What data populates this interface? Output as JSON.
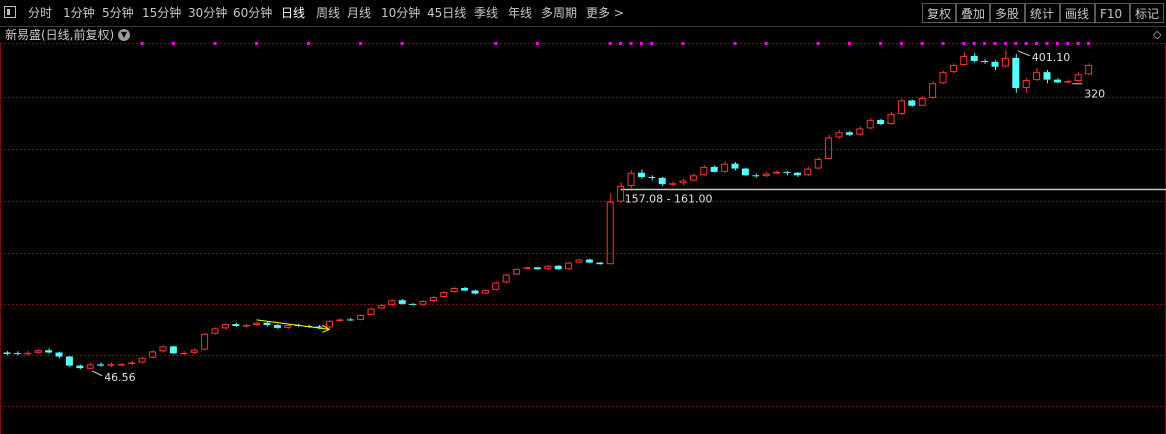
{
  "toolbar": {
    "periods": [
      {
        "label": "分时",
        "active": false
      },
      {
        "label": "1分钟",
        "active": false
      },
      {
        "label": "5分钟",
        "active": false
      },
      {
        "label": "15分钟",
        "active": false
      },
      {
        "label": "30分钟",
        "active": false
      },
      {
        "label": "60分钟",
        "active": false
      },
      {
        "label": "日线",
        "active": true
      },
      {
        "label": "周线",
        "active": false
      },
      {
        "label": "月线",
        "active": false
      },
      {
        "label": "10分钟",
        "active": false
      },
      {
        "label": "45日线",
        "active": false
      },
      {
        "label": "季线",
        "active": false
      },
      {
        "label": "年线",
        "active": false
      },
      {
        "label": "多周期",
        "active": false
      },
      {
        "label": "更多 >",
        "active": false
      }
    ],
    "right_buttons": [
      "复权",
      "叠加",
      "多股",
      "统计",
      "画线",
      "F10",
      "标记"
    ]
  },
  "stock_title": "新易盛(日线,前复权)",
  "colors": {
    "up": "#ff3232",
    "down": "#54ffff",
    "grid": "#7a1010",
    "marker": "#ff00ff",
    "trendline": "#ffff00",
    "level_line": "#c8c8c8",
    "active_tab": "#ffffff"
  },
  "chart_data": {
    "type": "candlestick",
    "y_range": [
      30,
      420
    ],
    "candles": [
      [
        52.0,
        51.5,
        52.5,
        51.0
      ],
      [
        51.8,
        51.6,
        52.4,
        51.0
      ],
      [
        51.5,
        51.9,
        52.5,
        51.0
      ],
      [
        51.9,
        52.8,
        53.2,
        51.5
      ],
      [
        52.8,
        52.0,
        53.5,
        51.6
      ],
      [
        52.0,
        50.6,
        52.3,
        50.0
      ],
      [
        50.6,
        47.6,
        50.8,
        47.2
      ],
      [
        47.6,
        46.8,
        48.0,
        46.4
      ],
      [
        46.6,
        48.0,
        48.6,
        46.56
      ],
      [
        48.0,
        47.6,
        48.6,
        47.2
      ],
      [
        47.6,
        48.1,
        48.6,
        47.2
      ],
      [
        48.1,
        48.1,
        48.6,
        47.6
      ],
      [
        48.1,
        48.6,
        49.2,
        47.8
      ],
      [
        48.6,
        50.2,
        50.6,
        48.4
      ],
      [
        50.2,
        52.4,
        52.8,
        50.0
      ],
      [
        52.4,
        54.2,
        54.5,
        52.0
      ],
      [
        54.2,
        51.7,
        54.5,
        51.4
      ],
      [
        51.7,
        51.9,
        52.4,
        51.2
      ],
      [
        51.9,
        53.0,
        53.5,
        51.5
      ],
      [
        53.0,
        59.0,
        59.4,
        52.8
      ],
      [
        59.0,
        61.2,
        61.6,
        58.6
      ],
      [
        61.2,
        63.0,
        63.4,
        60.6
      ],
      [
        63.0,
        62.2,
        63.6,
        61.8
      ],
      [
        62.2,
        62.6,
        63.0,
        61.6
      ],
      [
        62.6,
        63.6,
        64.0,
        62.0
      ],
      [
        63.6,
        62.6,
        64.2,
        62.0
      ],
      [
        62.6,
        61.4,
        63.0,
        61.0
      ],
      [
        61.4,
        62.6,
        63.0,
        61.0
      ],
      [
        62.6,
        62.2,
        63.2,
        61.8
      ],
      [
        62.2,
        62.0,
        62.8,
        61.4
      ],
      [
        62.0,
        61.6,
        62.6,
        61.0
      ],
      [
        61.6,
        64.4,
        64.8,
        61.4
      ],
      [
        64.4,
        65.0,
        65.4,
        64.0
      ],
      [
        65.0,
        64.8,
        65.6,
        64.4
      ],
      [
        64.8,
        67.0,
        67.4,
        64.6
      ],
      [
        67.0,
        70.0,
        70.4,
        66.8
      ],
      [
        70.0,
        71.6,
        72.0,
        69.6
      ],
      [
        71.6,
        74.0,
        74.4,
        71.2
      ],
      [
        74.0,
        72.2,
        74.6,
        71.8
      ],
      [
        72.2,
        71.8,
        72.6,
        71.4
      ],
      [
        71.8,
        73.6,
        74.0,
        71.4
      ],
      [
        73.6,
        75.6,
        76.0,
        73.2
      ],
      [
        75.6,
        78.2,
        78.6,
        75.2
      ],
      [
        78.2,
        80.4,
        80.8,
        77.8
      ],
      [
        80.4,
        79.0,
        81.0,
        78.6
      ],
      [
        79.0,
        77.4,
        79.4,
        77.0
      ],
      [
        77.4,
        79.4,
        79.8,
        77.0
      ],
      [
        79.4,
        83.4,
        83.8,
        79.0
      ],
      [
        83.4,
        88.0,
        88.4,
        83.0
      ],
      [
        88.0,
        91.4,
        91.8,
        87.6
      ],
      [
        91.4,
        92.4,
        92.8,
        91.0
      ],
      [
        92.4,
        91.2,
        92.8,
        90.8
      ],
      [
        91.2,
        93.4,
        93.8,
        90.8
      ],
      [
        93.4,
        91.2,
        93.8,
        90.8
      ],
      [
        91.2,
        95.4,
        95.8,
        90.8
      ],
      [
        95.4,
        97.4,
        97.8,
        95.0
      ],
      [
        97.4,
        95.4,
        98.0,
        95.0
      ],
      [
        95.4,
        94.4,
        95.8,
        94.0
      ],
      [
        94.4,
        144.0,
        152.0,
        94.0
      ],
      [
        144.0,
        160.0,
        164.0,
        143.0
      ],
      [
        160.0,
        175.0,
        178.0,
        158.0
      ],
      [
        175.0,
        170.0,
        179.0,
        168.0
      ],
      [
        170.0,
        169.0,
        172.0,
        166.0
      ],
      [
        169.0,
        162.0,
        170.0,
        160.0
      ],
      [
        162.0,
        163.0,
        165.0,
        160.0
      ],
      [
        163.0,
        166.0,
        168.0,
        161.0
      ],
      [
        166.0,
        172.0,
        174.0,
        165.0
      ],
      [
        172.0,
        182.0,
        184.0,
        171.0
      ],
      [
        182.0,
        176.0,
        184.0,
        175.0
      ],
      [
        176.0,
        186.0,
        189.0,
        175.0
      ],
      [
        186.0,
        180.0,
        188.0,
        178.0
      ],
      [
        180.0,
        172.0,
        181.0,
        171.0
      ],
      [
        172.0,
        171.0,
        174.0,
        169.0
      ],
      [
        171.0,
        174.0,
        176.0,
        170.0
      ],
      [
        174.0,
        176.0,
        178.0,
        173.0
      ],
      [
        176.0,
        175.0,
        177.0,
        172.0
      ],
      [
        175.0,
        172.0,
        176.0,
        170.0
      ],
      [
        172.0,
        180.0,
        182.0,
        171.0
      ],
      [
        180.0,
        192.0,
        194.0,
        179.0
      ],
      [
        192.0,
        222.0,
        226.0,
        191.0
      ],
      [
        222.0,
        230.0,
        233.0,
        220.0
      ],
      [
        230.0,
        226.0,
        232.0,
        224.0
      ],
      [
        226.0,
        236.0,
        239.0,
        225.0
      ],
      [
        236.0,
        250.0,
        253.0,
        235.0
      ],
      [
        250.0,
        243.0,
        252.0,
        241.0
      ],
      [
        243.0,
        260.0,
        264.0,
        242.0
      ],
      [
        260.0,
        285.0,
        289.0,
        258.0
      ],
      [
        285.0,
        275.0,
        287.0,
        273.0
      ],
      [
        275.0,
        290.0,
        294.0,
        274.0
      ],
      [
        290.0,
        320.0,
        324.0,
        288.0
      ],
      [
        320.0,
        345.0,
        348.0,
        318.0
      ],
      [
        345.0,
        362.0,
        366.0,
        342.0
      ],
      [
        362.0,
        385.0,
        395.0,
        360.0
      ],
      [
        385.0,
        372.0,
        392.0,
        368.0
      ],
      [
        372.0,
        370.0,
        376.0,
        365.0
      ],
      [
        370.0,
        358.0,
        374.0,
        350.0
      ],
      [
        358.0,
        380.0,
        401.1,
        356.0
      ],
      [
        380.0,
        310.0,
        390.0,
        300.0
      ],
      [
        310.0,
        327.0,
        332.0,
        300.0
      ],
      [
        327.0,
        345.0,
        355.0,
        325.0
      ],
      [
        345.0,
        328.0,
        350.0,
        320.0
      ],
      [
        328.0,
        322.0,
        331.0,
        320.0
      ],
      [
        322.0,
        325.0,
        328.0,
        320.0
      ],
      [
        325.0,
        340.0,
        345.0,
        323.0
      ],
      [
        340.0,
        362.0,
        366.0,
        338.0
      ]
    ],
    "top_markers_at_candle_index": [
      13,
      16,
      20,
      24,
      29,
      34,
      38,
      47,
      51,
      58,
      59,
      60,
      61,
      62,
      65,
      70,
      73,
      78,
      81,
      84,
      86,
      88,
      90,
      92,
      93,
      94,
      95,
      96,
      97,
      98,
      99,
      100,
      101,
      102,
      103,
      104
    ],
    "annotations": [
      {
        "text": "46.56",
        "value": 46.56,
        "candle_index": 8
      },
      {
        "text": "401.10",
        "value": 401.1,
        "candle_index": 97
      },
      {
        "text": "320",
        "value": 320,
        "candle_index": 103
      },
      {
        "text": "157.08 - 161.00",
        "value": 157.08,
        "candle_index": 59
      }
    ],
    "horizontal_level": {
      "value": 157.08,
      "from_candle_index": 59,
      "label": "157.08 - 161.00"
    },
    "trendline": {
      "from_candle_index": 24,
      "from_value": 64.8,
      "to_candle_index": 31,
      "to_value": 60.8
    }
  }
}
